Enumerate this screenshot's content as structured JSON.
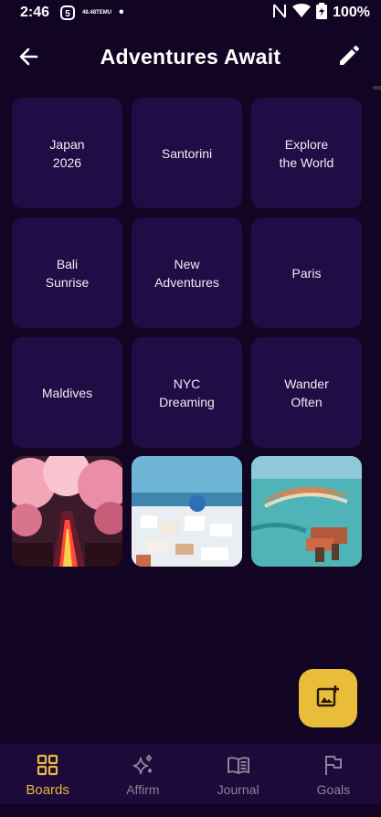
{
  "status": {
    "time": "2:46",
    "temu_small": "48.48",
    "temu_label": "TEMU",
    "dot": "•",
    "battery": "100%"
  },
  "app_bar": {
    "title": "Adventures Await"
  },
  "board": {
    "tiles": [
      {
        "label": "Japan\n2026"
      },
      {
        "label": "Santorini"
      },
      {
        "label": "Explore\nthe World"
      },
      {
        "label": "Bali\nSunrise"
      },
      {
        "label": "New\nAdventures"
      },
      {
        "label": "Paris"
      },
      {
        "label": "Maldives"
      },
      {
        "label": "NYC\nDreaming"
      },
      {
        "label": "Wander\nOften"
      }
    ],
    "photos": [
      {
        "icon": "cherry-blossom-photo"
      },
      {
        "icon": "santorini-photo"
      },
      {
        "icon": "overwater-villa-photo"
      }
    ]
  },
  "nav": {
    "items": [
      {
        "label": "Boards",
        "icon": "grid-icon",
        "active": true
      },
      {
        "label": "Affirm",
        "icon": "sparkle-icon",
        "active": false
      },
      {
        "label": "Journal",
        "icon": "book-icon",
        "active": false
      },
      {
        "label": "Goals",
        "icon": "flag-icon",
        "active": false
      }
    ]
  },
  "colors": {
    "background": "#120524",
    "tile": "#220c45",
    "accent": "#e9bd39",
    "nav_bg": "#1d0a3a",
    "nav_inactive": "#8c8299"
  }
}
